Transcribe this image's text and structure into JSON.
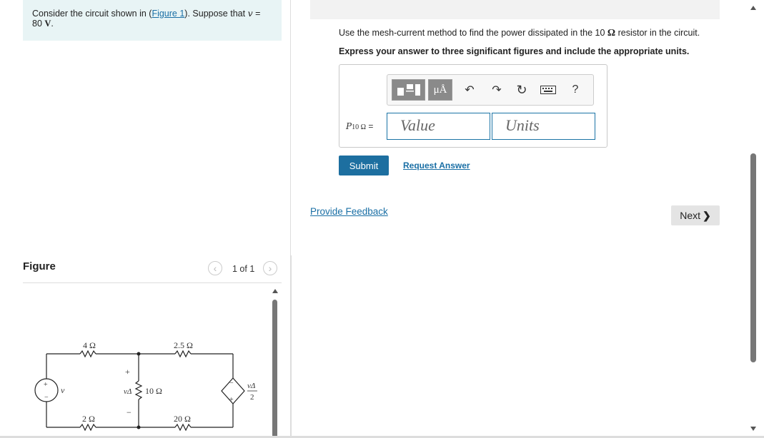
{
  "prompt": {
    "text_before_link": "Consider the circuit shown in (",
    "link": "Figure 1",
    "text_after_link": "). Suppose that ",
    "var": "v",
    "equals": " =",
    "value": "80",
    "unit": "V",
    "period": "."
  },
  "figure": {
    "title": "Figure",
    "pager": "1 of 1",
    "circuit": {
      "r_top_left": "4 Ω",
      "r_top_right": "2.5 Ω",
      "r_mid": "10 Ω",
      "r_bottom_left": "2 Ω",
      "r_bottom_right": "20 Ω",
      "source_label": "v",
      "v_delta_label": "vΔ",
      "plus": "+",
      "minus": "−",
      "dep_source_num": "vΔ",
      "dep_source_den": "2"
    }
  },
  "question": {
    "instruction_before": "Use the mesh-current method to find the power dissipated in the 10 ",
    "instruction_omega": "Ω",
    "instruction_after": " resistor in the circuit.",
    "express": "Express your answer to three significant figures and include the appropriate units.",
    "answer_label": "P",
    "answer_sub": "10 Ω",
    "answer_eq": " =",
    "value_placeholder": "Value",
    "units_placeholder": "Units",
    "toolbar": {
      "units_btn": "μÅ",
      "help": "?"
    },
    "submit": "Submit",
    "request_answer": "Request Answer"
  },
  "footer": {
    "provide_feedback": "Provide Feedback",
    "next": "Next"
  }
}
